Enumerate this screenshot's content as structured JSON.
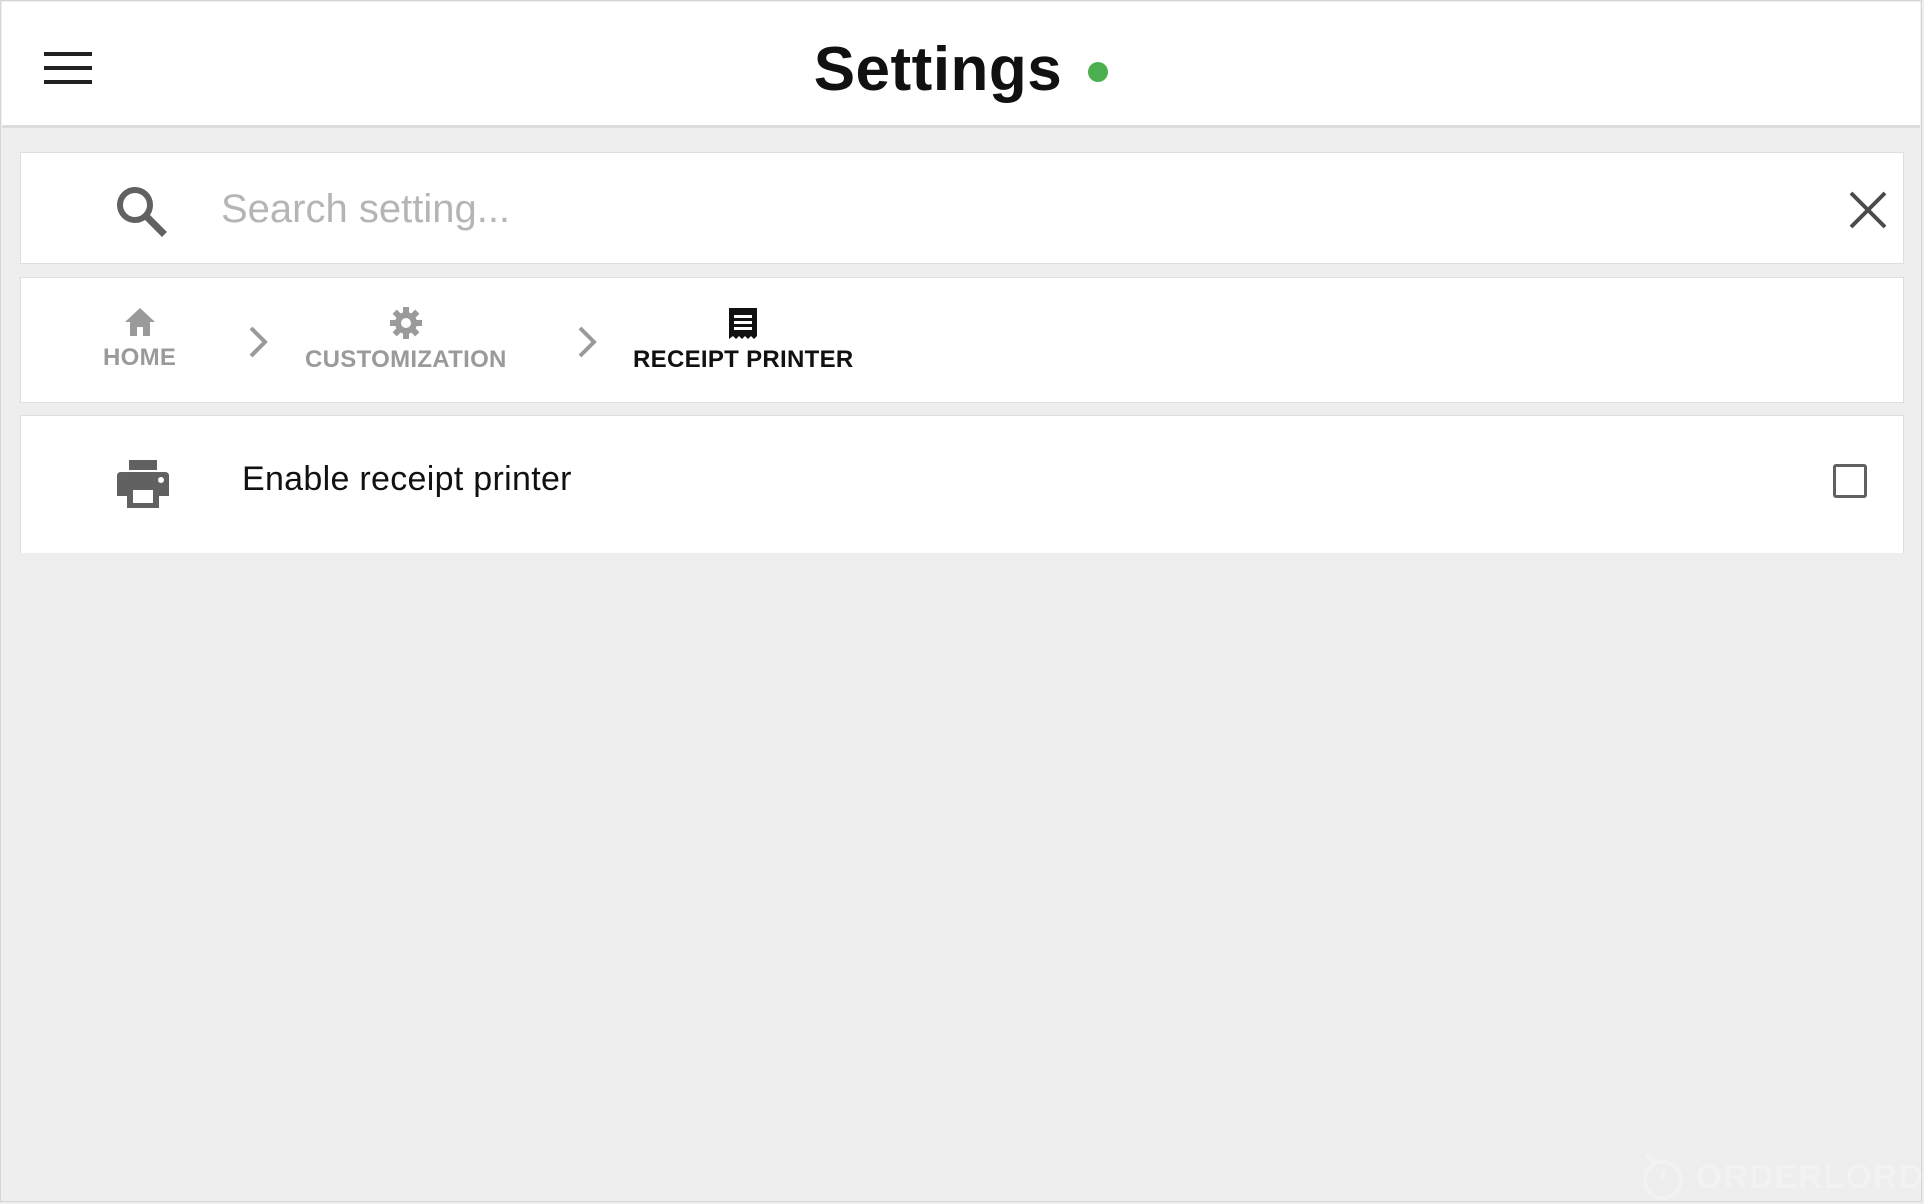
{
  "header": {
    "menu_icon": "hamburger-menu-icon",
    "title": "Settings",
    "status_color": "#4caf50"
  },
  "search": {
    "icon": "search-icon",
    "placeholder": "Search setting...",
    "value": "",
    "clear_icon": "close-icon"
  },
  "breadcrumb": {
    "items": [
      {
        "label": "HOME",
        "icon": "home-icon",
        "active": false
      },
      {
        "label": "CUSTOMIZATION",
        "icon": "gear-icon",
        "active": false
      },
      {
        "label": "RECEIPT PRINTER",
        "icon": "receipt-icon",
        "active": true
      }
    ],
    "separator_icon": "chevron-right-icon"
  },
  "settings": [
    {
      "icon": "printer-icon",
      "label": "Enable receipt printer",
      "checked": false
    }
  ],
  "watermark": {
    "text": "ORDERLORD"
  },
  "colors": {
    "background": "#eeeeee",
    "card": "#ffffff",
    "inactive_crumb": "#9a9a9a",
    "active_crumb": "#111111",
    "icon_gray": "#616161"
  }
}
